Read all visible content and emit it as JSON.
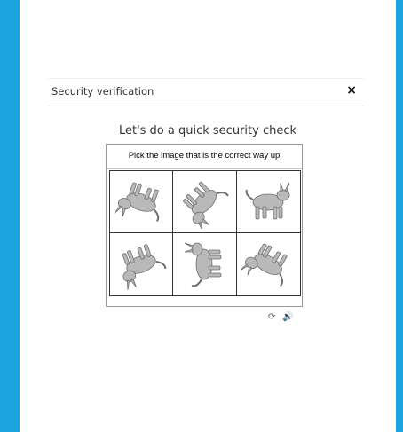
{
  "header": {
    "title": "Security verification",
    "close_glyph": "×"
  },
  "main": {
    "heading": "Let's do a quick security check",
    "instruction": "Pick the image that is the correct way up"
  },
  "tiles": [
    {
      "name": "rotated-animal",
      "rotation": 200
    },
    {
      "name": "rotated-animal",
      "rotation": 135
    },
    {
      "name": "upright-animal",
      "rotation": 0
    },
    {
      "name": "rotated-animal",
      "rotation": 160
    },
    {
      "name": "rotated-animal",
      "rotation": 270
    },
    {
      "name": "rotated-animal",
      "rotation": 210
    }
  ],
  "footer": {
    "refresh_glyph": "⟳",
    "audio_glyph": "🔊"
  },
  "colors": {
    "background": "#1aa3dd",
    "animal": "#b9b9b9"
  }
}
